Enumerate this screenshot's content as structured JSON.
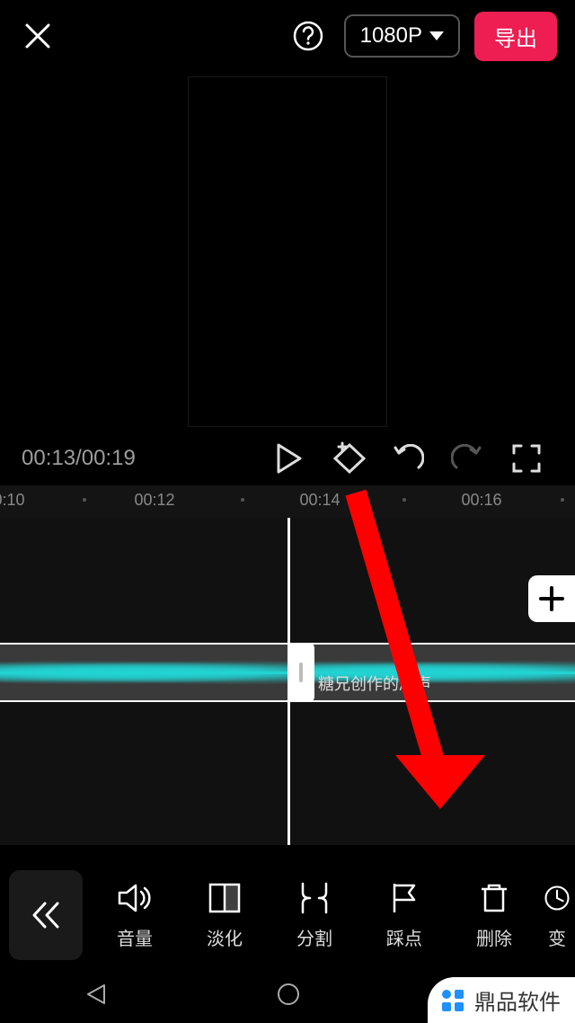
{
  "header": {
    "resolution": "1080P",
    "export": "导出"
  },
  "playback": {
    "current_time": "00:13",
    "total_time": "00:19"
  },
  "timeline": {
    "ticks": [
      "0:10",
      "00:12",
      "00:14",
      "00:16"
    ],
    "audio_clip_label": "糖兄创作的原声"
  },
  "toolbar": {
    "items": [
      {
        "name": "volume",
        "label": "音量"
      },
      {
        "name": "fade",
        "label": "淡化"
      },
      {
        "name": "split",
        "label": "分割"
      },
      {
        "name": "beat",
        "label": "踩点"
      },
      {
        "name": "delete",
        "label": "删除"
      },
      {
        "name": "speed",
        "label": "变"
      }
    ]
  },
  "watermark": {
    "text": "鼎品软件"
  }
}
